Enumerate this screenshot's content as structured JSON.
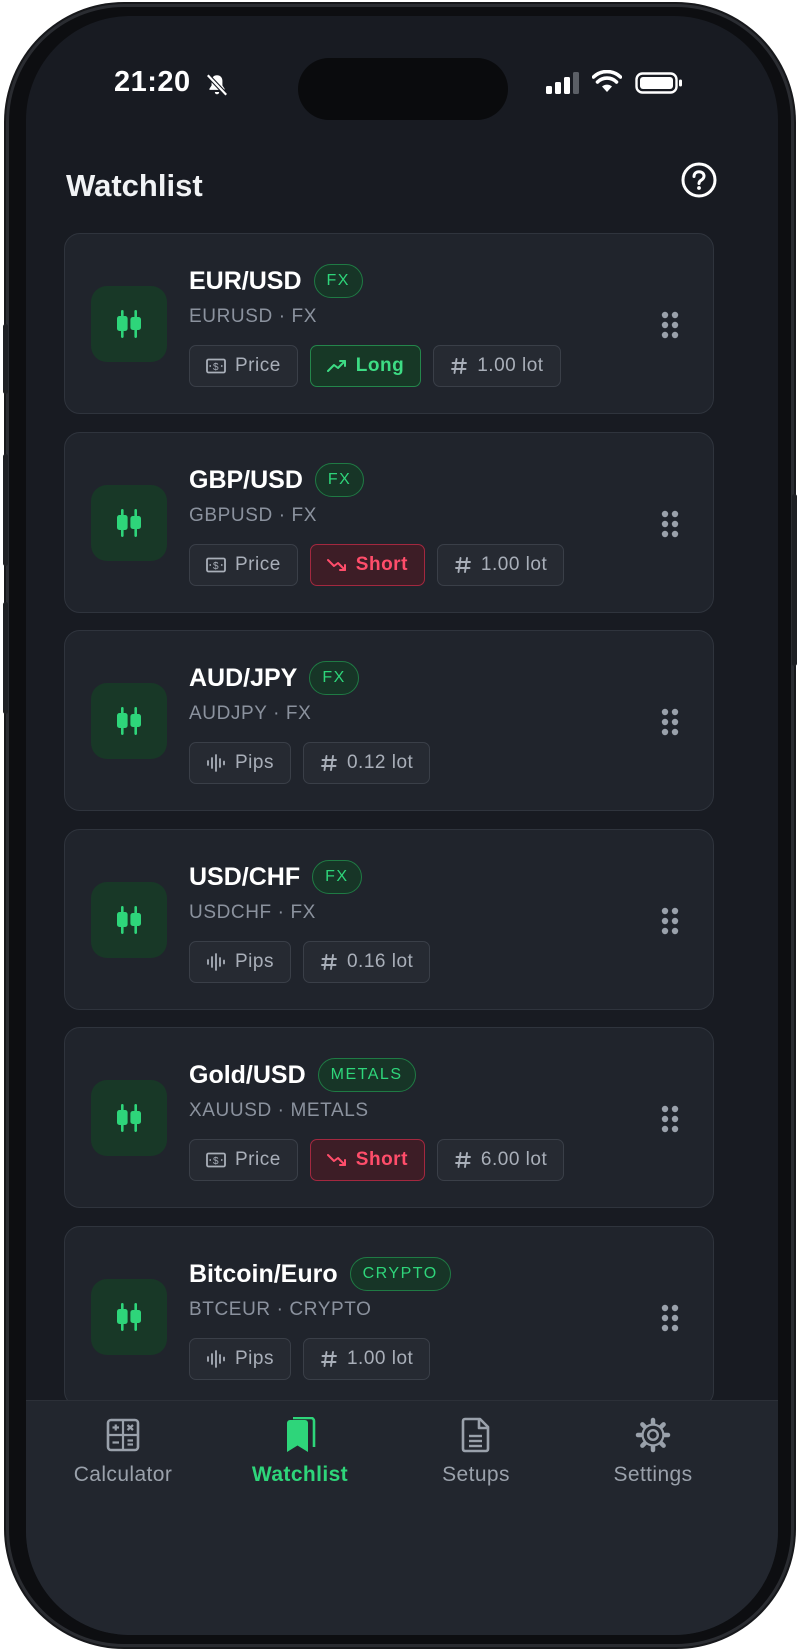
{
  "status_bar": {
    "time": "21:20"
  },
  "header": {
    "title": "Watchlist"
  },
  "watchlist": [
    {
      "name": "EUR/USD",
      "badge": "FX",
      "subtitle": "EURUSD · FX",
      "chips": [
        {
          "kind": "price",
          "label": "Price"
        },
        {
          "kind": "long",
          "label": "Long"
        },
        {
          "kind": "lot",
          "label": "1.00 lot"
        }
      ]
    },
    {
      "name": "GBP/USD",
      "badge": "FX",
      "subtitle": "GBPUSD · FX",
      "chips": [
        {
          "kind": "price",
          "label": "Price"
        },
        {
          "kind": "short",
          "label": "Short"
        },
        {
          "kind": "lot",
          "label": "1.00 lot"
        }
      ]
    },
    {
      "name": "AUD/JPY",
      "badge": "FX",
      "subtitle": "AUDJPY · FX",
      "chips": [
        {
          "kind": "pips",
          "label": "Pips"
        },
        {
          "kind": "lot",
          "label": "0.12 lot"
        }
      ]
    },
    {
      "name": "USD/CHF",
      "badge": "FX",
      "subtitle": "USDCHF · FX",
      "chips": [
        {
          "kind": "pips",
          "label": "Pips"
        },
        {
          "kind": "lot",
          "label": "0.16 lot"
        }
      ]
    },
    {
      "name": "Gold/USD",
      "badge": "METALS",
      "subtitle": "XAUUSD · METALS",
      "chips": [
        {
          "kind": "price",
          "label": "Price"
        },
        {
          "kind": "short",
          "label": "Short"
        },
        {
          "kind": "lot",
          "label": "6.00 lot"
        }
      ]
    },
    {
      "name": "Bitcoin/Euro",
      "badge": "CRYPTO",
      "subtitle": "BTCEUR · CRYPTO",
      "chips": [
        {
          "kind": "pips",
          "label": "Pips"
        },
        {
          "kind": "lot",
          "label": "1.00 lot"
        }
      ]
    }
  ],
  "tabs": [
    {
      "label": "Calculator",
      "icon": "calculator-icon",
      "active": false
    },
    {
      "label": "Watchlist",
      "icon": "bookmark-icon",
      "active": true
    },
    {
      "label": "Setups",
      "icon": "document-icon",
      "active": false
    },
    {
      "label": "Settings",
      "icon": "gear-icon",
      "active": false
    }
  ],
  "colors": {
    "accent": "#2ed57a",
    "long": "#3ddc84",
    "short": "#ff4d6a",
    "background": "#181b22",
    "card": "#20242c"
  }
}
